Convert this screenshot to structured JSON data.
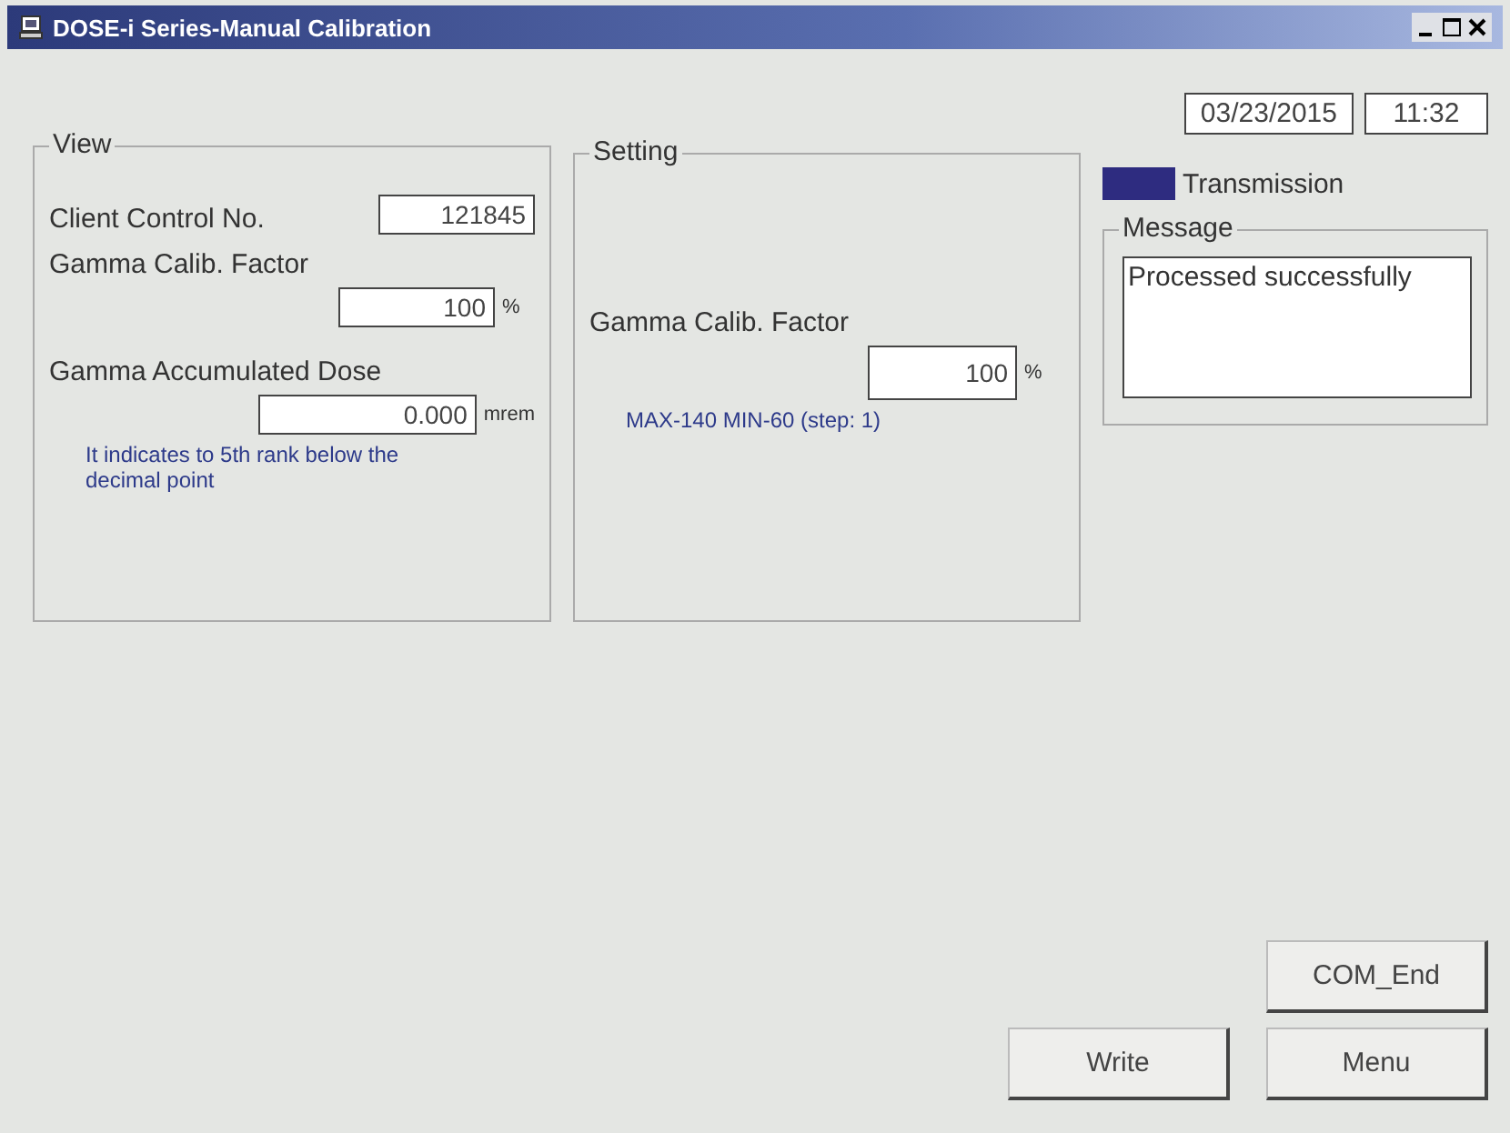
{
  "window": {
    "title": "DOSE-i Series-Manual Calibration"
  },
  "header": {
    "date": "03/23/2015",
    "time": "11:32"
  },
  "view": {
    "title": "View",
    "client_control": {
      "label": "Client Control No.",
      "value": "121845"
    },
    "calib_factor": {
      "label": "Gamma Calib. Factor",
      "value": "100",
      "unit": "%"
    },
    "accumulated_dose": {
      "label": "Gamma Accumulated Dose",
      "value": "0.000",
      "unit": "mrem",
      "note": "It indicates to 5th rank below the decimal point"
    }
  },
  "setting": {
    "title": "Setting",
    "calib_factor": {
      "label": "Gamma Calib. Factor",
      "value": "100",
      "unit": "%"
    },
    "range": "MAX-140  MIN-60 (step: 1)"
  },
  "transmission": {
    "label": "Transmission",
    "on": true
  },
  "message": {
    "title": "Message",
    "text": "Processed successfully"
  },
  "buttons": [
    {
      "label": "COM_End",
      "kind": "com_end"
    },
    {
      "label": "Write",
      "kind": "write"
    },
    {
      "label": "Menu",
      "kind": "menu"
    }
  ]
}
